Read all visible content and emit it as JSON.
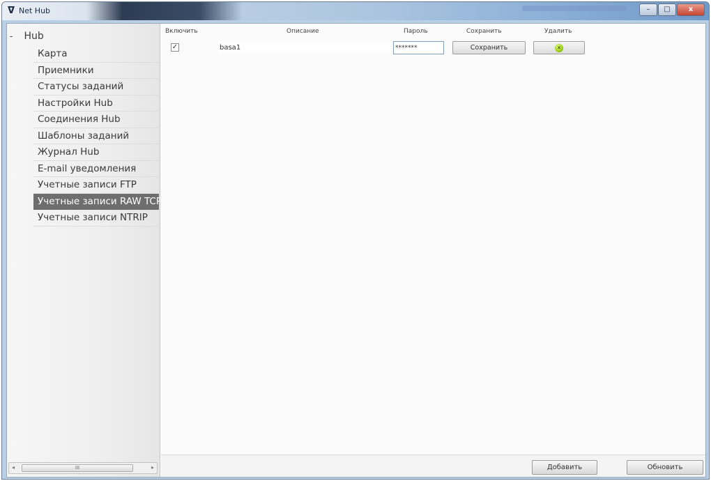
{
  "window": {
    "title": "Net Hub",
    "app_icon": "net-hub-icon",
    "controls": {
      "minimize": "–",
      "maximize": "□",
      "close": "x"
    }
  },
  "sidebar": {
    "root": {
      "label": "Hub",
      "toggle": "-"
    },
    "items": [
      {
        "label": "Карта"
      },
      {
        "label": "Приемники"
      },
      {
        "label": "Статусы заданий"
      },
      {
        "label": "Настройки Hub"
      },
      {
        "label": "Соединения Hub"
      },
      {
        "label": "Шаблоны заданий"
      },
      {
        "label": "Журнал Hub"
      },
      {
        "label": "E-mail уведомления"
      },
      {
        "label": "Учетные записи FTP"
      },
      {
        "label": "Учетные записи RAW TCP",
        "selected": true
      },
      {
        "label": "Учетные записи NTRIP"
      }
    ],
    "scrollbar": {
      "thumb_label": "III"
    }
  },
  "grid": {
    "headers": {
      "enable": "Включить",
      "description": "Описание",
      "password": "Пароль",
      "save": "Сохранить",
      "delete": "Удалить"
    },
    "rows": [
      {
        "enabled": true,
        "check_mark": "✓",
        "description": "basa1",
        "password": "*******",
        "save_label": "Сохранить",
        "delete_icon": "delete-icon"
      }
    ]
  },
  "footer": {
    "add_label": "Добавить",
    "refresh_label": "Обновить"
  },
  "colors": {
    "selected_item_bg": "#6e6e6e",
    "delete_icon": "#9acb17"
  }
}
